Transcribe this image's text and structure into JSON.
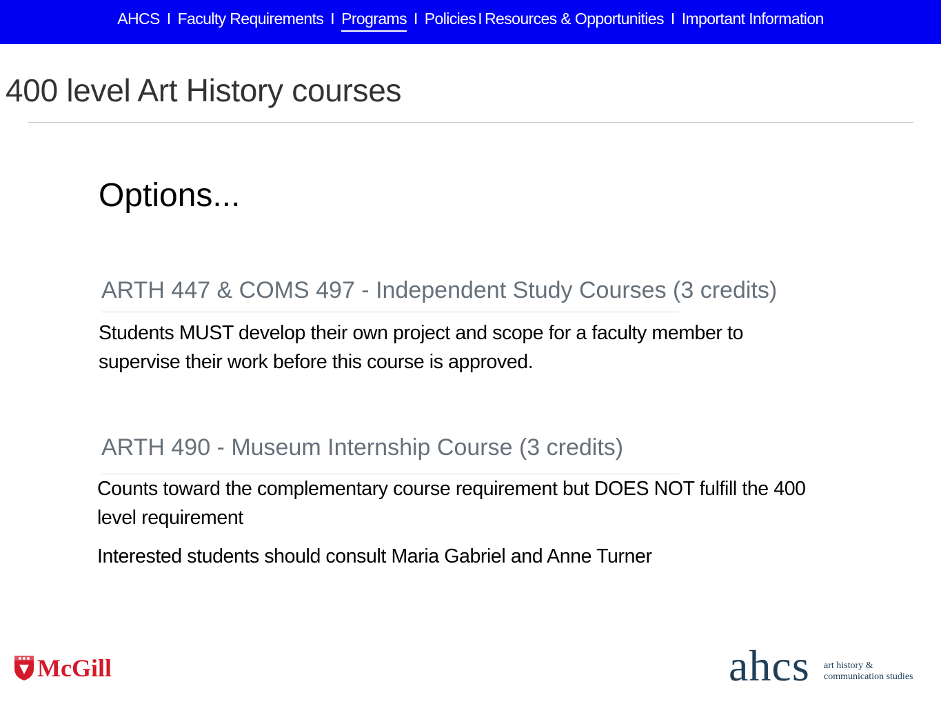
{
  "nav": {
    "items": [
      {
        "label": "AHCS"
      },
      {
        "label": "Faculty Requirements"
      },
      {
        "label": "Programs"
      },
      {
        "label": "Policies"
      },
      {
        "label": "Resources & Opportunities"
      },
      {
        "label": "Important Information"
      }
    ],
    "separator": "I",
    "active": "Programs"
  },
  "page": {
    "title": "400 level Art History courses",
    "options_heading": "Options..."
  },
  "sections": [
    {
      "heading": "ARTH 447 & COMS 497 - Independent Study Courses (3 credits)",
      "paragraphs": [
        "Students MUST develop their own project and scope for a faculty member to supervise their work before this course is approved."
      ]
    },
    {
      "heading": "ARTH 490 - Museum Internship Course (3 credits)",
      "paragraphs": [
        "Counts toward the complementary course requirement but DOES NOT fulfill the 400 level requirement",
        "Interested students should consult Maria Gabriel and Anne Turner"
      ]
    }
  ],
  "footer": {
    "mcgill_logo": {
      "text": "McGill",
      "color": "#d3192a"
    },
    "ahcs_logo": {
      "mark": "ahcs",
      "tagline_line1": "art history &",
      "tagline_line2": "communication studies",
      "color": "#1f3e57"
    }
  },
  "colors": {
    "nav_bg": "#0000f2",
    "heading_gray": "#66707a"
  }
}
